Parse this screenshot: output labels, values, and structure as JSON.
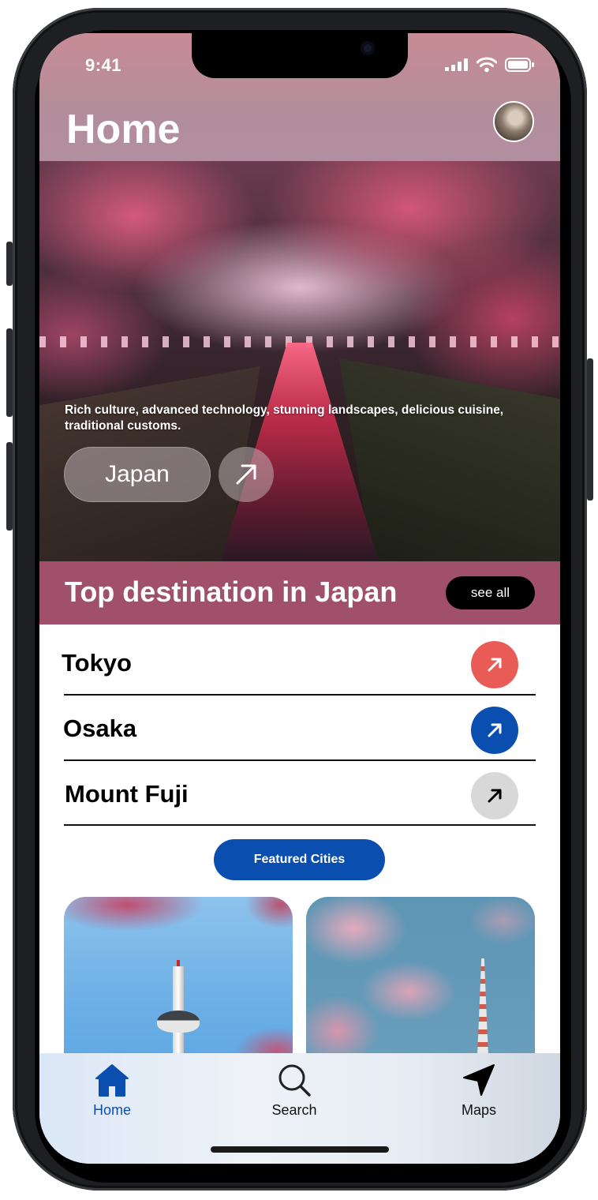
{
  "status_bar": {
    "time": "9:41"
  },
  "header": {
    "title": "Home"
  },
  "hero": {
    "description": "Rich culture, advanced technology, stunning landscapes, delicious cuisine, traditional customs.",
    "country": "Japan"
  },
  "section": {
    "title": "Top destination in Japan",
    "see_all": "see all"
  },
  "destinations": [
    {
      "name": "Tokyo",
      "button_color": "#e85c55",
      "arrow_color": "#ffffff"
    },
    {
      "name": "Osaka",
      "button_color": "#0a4fb0",
      "arrow_color": "#ffffff"
    },
    {
      "name": "Mount Fuji",
      "button_color": "#d8d8d8",
      "arrow_color": "#000000"
    }
  ],
  "featured": {
    "label": "Featured Cities"
  },
  "tabbar": {
    "tabs": [
      {
        "label": "Home",
        "icon": "home-icon",
        "active": true
      },
      {
        "label": "Search",
        "icon": "search-icon",
        "active": false
      },
      {
        "label": "Maps",
        "icon": "navigation-arrow-icon",
        "active": false
      }
    ]
  },
  "colors": {
    "accent": "#0a4fb0",
    "section_band": "#a0506a"
  }
}
